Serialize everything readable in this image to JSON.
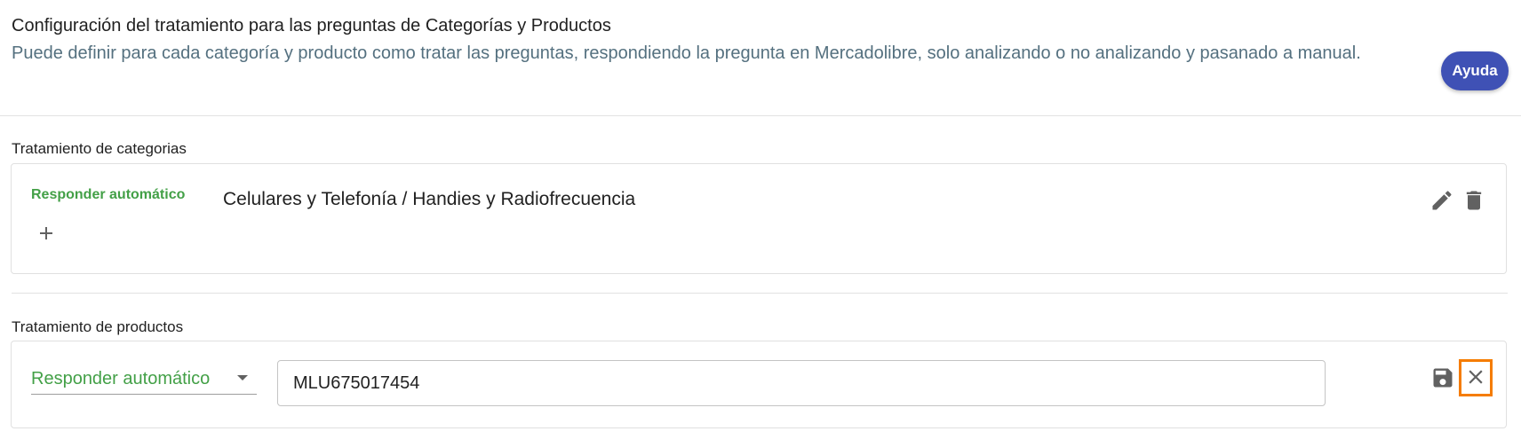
{
  "header": {
    "title": "Configuración del tratamiento para las preguntas de Categorías y Productos",
    "description": "Puede definir para cada categoría y producto como tratar las preguntas, respondiendo la pregunta en Mercadolibre, solo analizando o no analizando y pasanado a manual.",
    "help_label": "Ayuda"
  },
  "categories": {
    "section_label": "Tratamiento de categorias",
    "items": [
      {
        "mode": "Responder automático",
        "name": "Celulares y Telefonía / Handies y Radiofrecuencia"
      }
    ]
  },
  "products": {
    "section_label": "Tratamiento de productos",
    "mode_selected": "Responder automático",
    "product_id": "MLU675017454"
  },
  "colors": {
    "accent": "#3f51b5",
    "mode_green": "#43a047",
    "focus_orange": "#f57c00",
    "icon_gray": "#616161"
  },
  "icons": [
    "edit-icon",
    "delete-icon",
    "add-icon",
    "save-icon",
    "close-icon",
    "dropdown-arrow-icon"
  ]
}
